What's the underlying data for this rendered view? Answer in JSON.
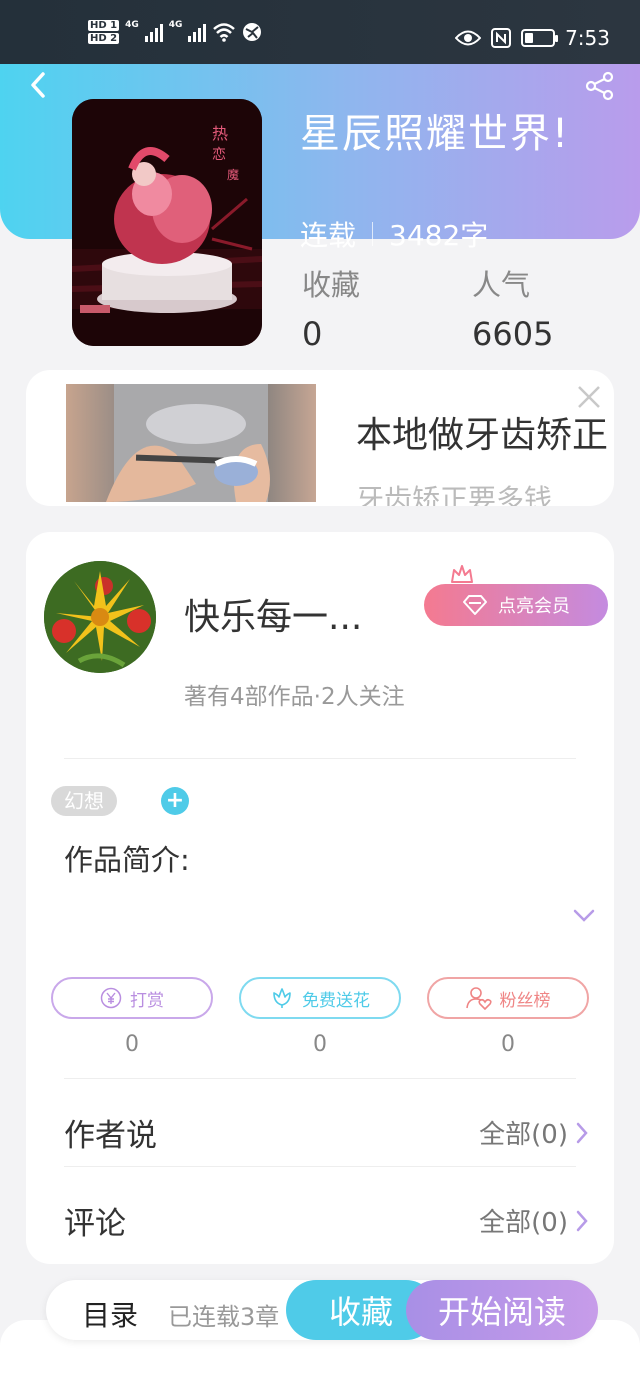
{
  "status_bar": {
    "network_badges": [
      "HD 1",
      "HD 2"
    ],
    "network_type_1": "4G",
    "network_type_2": "4G",
    "time": "7:53"
  },
  "book": {
    "title": "星辰照耀世界!",
    "status": "连载",
    "word_count": "3482字",
    "favorites_label": "收藏",
    "favorites_value": "0",
    "popularity_label": "人气",
    "popularity_value": "6605"
  },
  "ad": {
    "title": "本地做牙齿矫正",
    "subtitle": "牙齿矫正要多钱"
  },
  "author": {
    "name": "快乐每一...",
    "vip_label": "点亮会员",
    "stats": "著有4部作品·2人关注"
  },
  "tags": [
    "幻想"
  ],
  "tag_add": "+",
  "intro_label": "作品简介:",
  "actions": [
    {
      "label": "打赏",
      "count": "0",
      "color": "#b98ee0",
      "icon": "yen-icon"
    },
    {
      "label": "免费送花",
      "count": "0",
      "color": "#4fcbe8",
      "icon": "flower-icon"
    },
    {
      "label": "粉丝榜",
      "count": "0",
      "color": "#ef8585",
      "icon": "fan-rank-icon"
    }
  ],
  "rows": [
    {
      "label": "作者说",
      "value": "全部(0)"
    },
    {
      "label": "评论",
      "value": "全部(0)"
    }
  ],
  "bottom": {
    "toc_label": "目录",
    "toc_sub": "已连载3章",
    "collect_label": "收藏",
    "read_label": "开始阅读"
  },
  "colors": {
    "accent_cyan": "#4fcbe8",
    "accent_purple": "#b99cec",
    "accent_pink": "#f47a90"
  }
}
